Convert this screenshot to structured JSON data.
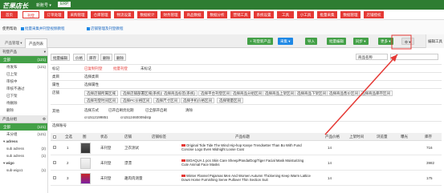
{
  "topbar": {
    "logo": "芒果店长",
    "account": "新账号 ▾",
    "erp": "ERP"
  },
  "nav": [
    {
      "label": "首页",
      "active": false
    },
    {
      "label": "刊登",
      "active": true
    },
    {
      "label": "订单处理",
      "active": false
    },
    {
      "label": "采购管理",
      "active": false
    },
    {
      "label": "仓库管理",
      "active": false
    },
    {
      "label": "物流设置",
      "active": false
    },
    {
      "label": "数据统计",
      "active": false
    },
    {
      "label": "财务管理",
      "active": false
    },
    {
      "label": "商品数据",
      "active": false
    },
    {
      "label": "数据分析",
      "active": false
    },
    {
      "label": "营销工具",
      "active": false
    },
    {
      "label": "系统设置",
      "active": false
    },
    {
      "label": "工具",
      "active": false
    },
    {
      "label": "小工具",
      "active": false
    },
    {
      "label": "批量采集",
      "active": false
    },
    {
      "label": "数据管理",
      "active": false
    },
    {
      "label": "店铺授权",
      "active": false
    }
  ],
  "subnav": {
    "label": "使用帮助",
    "link1": "批量采集并刊登视频教程",
    "link2": "店铺管理及刊登教程"
  },
  "tabs": {
    "tab1": "产品管理 ▾",
    "tab2": "产品列表"
  },
  "toolbar": {
    "publish": "+ 刊登新产品",
    "collect": "采集 ▾",
    "import": "导入",
    "batch": "批量编辑",
    "sync": "同步 ▾",
    "more": "更多 ▾",
    "right": "编辑工具"
  },
  "sidebar": {
    "sec1": {
      "title": "刊登产品",
      "items": [
        {
          "label": "全部",
          "count": "(121)",
          "sel": true
        },
        {
          "label": "待发布",
          "count": "(121)",
          "sel": false
        },
        {
          "label": "已上架",
          "count": "",
          "sel": false
        },
        {
          "label": "审核中",
          "count": "",
          "sel": false
        },
        {
          "label": "审核不通过",
          "count": "",
          "sel": false
        },
        {
          "label": "已下架",
          "count": "",
          "sel": false
        },
        {
          "label": "待删除",
          "count": "",
          "sel": false
        },
        {
          "label": "删除",
          "count": "",
          "sel": false
        }
      ]
    },
    "sec2": {
      "title": "产品分组",
      "items": [
        {
          "label": "全部",
          "count": "(121)",
          "sel": true
        },
        {
          "label": "未分组",
          "count": "(121)",
          "sel": false
        }
      ]
    },
    "sec3": {
      "title": "adress",
      "items": [
        {
          "label": "sub adress",
          "count": "(2)",
          "sel": false
        },
        {
          "label": "sub adress",
          "count": "(1)",
          "sel": false
        }
      ]
    },
    "sec4": {
      "title": "wigo",
      "items": [
        {
          "label": "sub-wigo1",
          "count": "(1)",
          "sel": false
        }
      ]
    }
  },
  "filter": {
    "toolbar": [
      "批量编辑",
      "价格",
      "库存",
      "删除",
      "删除"
    ],
    "row_tags": {
      "label": "标记",
      "chips": [
        "已复制刊登",
        "批量刊登",
        "未标记"
      ]
    },
    "row_cat": {
      "label": "类目",
      "chips": [
        "选择类目"
      ]
    },
    "row_attr": {
      "label": "属性",
      "chips": [
        "选择属性"
      ]
    },
    "row_shop": {
      "label": "店铺",
      "chips": [
        "选择店铺所属区域",
        "选择店铺部署区域(系统)",
        "选择商品标签(系统)",
        "选择平台刊登区间",
        "选择商品分组区间",
        "选择商品上架区间",
        "选择商品下架区间",
        "选择商品售价区间",
        "选择商品库存区间"
      ]
    },
    "row_more": {
      "chips": [
        "选择刊登时间区间",
        "选择PC价格区间",
        "选择尺寸区间",
        "选择手机价格区间",
        "选择销量区间"
      ]
    },
    "row_other": {
      "label": "其他",
      "chips": [
        "选择方式",
        "已开启刷优化期",
        "已全部开启刷",
        "清除"
      ]
    },
    "row_search": {
      "label": "选择账号",
      "v1": "cn1512199851",
      "v2": "cn1512460009dstp"
    },
    "sort": "商品名称"
  },
  "table": {
    "headers": [
      "全选",
      "图",
      "状态",
      "店铺",
      "店铺标签",
      "产品标题",
      "产品价格",
      "上架时间",
      "浏览量",
      "曝光",
      "库存"
    ],
    "rows": [
      {
        "status": "未刊登",
        "shop": "卫衣测试",
        "title": "Original Tide Tide The Wind Hip-hop Kanye Trendsetter Than Bo With Fund Concise Logo Even Midnight Loose Coat",
        "price": "14",
        "stock": "716"
      },
      {
        "status": "未刊登",
        "shop": "漂漂",
        "title": "BIOAQUA 1 pcs Skin Care Sheep/Panda/Dog/Tiger Facial Mask Moisturizing Cute Animal Face Masks",
        "price": "14",
        "stock": "3982"
      },
      {
        "status": "未刊登",
        "shop": "趣肉肉测量",
        "title": "Winter Flannel Pajamas Men And Women Autumn Thickening Keep Warm Lattice Down Home Furnishing Serve Pullover Thin Section Suit",
        "price": "14",
        "stock": "175"
      }
    ]
  }
}
